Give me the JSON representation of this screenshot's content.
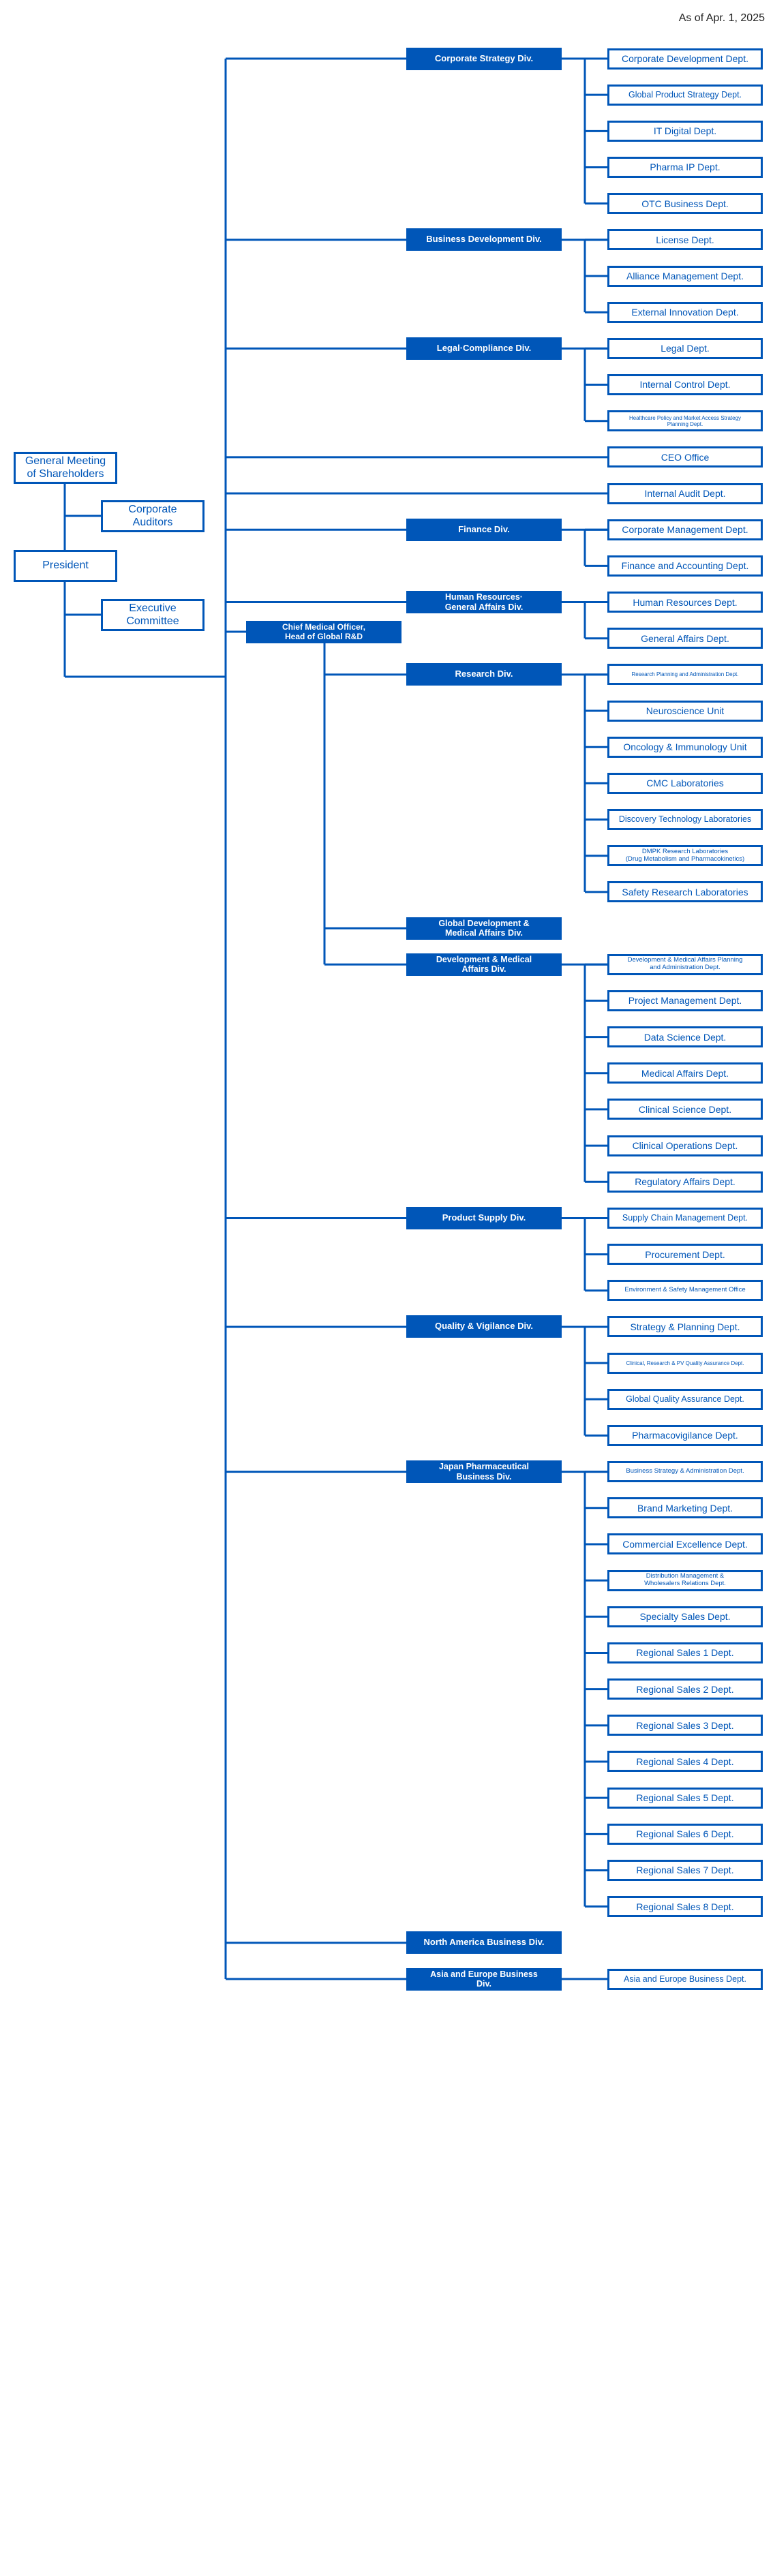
{
  "as_of": "As of Apr. 1, 2025",
  "colors": {
    "accent": "#0056b8",
    "background": "#ffffff"
  },
  "governance": {
    "general_meeting": "General Meeting\nof Shareholders",
    "corporate_auditors": "Corporate\nAuditors",
    "president": "President",
    "executive_committee": "Executive\nCommittee"
  },
  "cmo": "Chief Medical Officer,\nHead of Global R&D",
  "units": [
    {
      "type": "div",
      "name": "Corporate Strategy Div.",
      "depts": [
        "Corporate Development Dept.",
        "Global Product Strategy Dept.",
        "IT Digital Dept.",
        "Pharma IP Dept.",
        "OTC Business Dept."
      ]
    },
    {
      "type": "div",
      "name": "Business Development Div.",
      "depts": [
        "License Dept.",
        "Alliance Management Dept.",
        "External Innovation Dept."
      ]
    },
    {
      "type": "div",
      "name": "Legal·Compliance Div.",
      "depts": [
        "Legal Dept.",
        "Internal Control Dept.",
        "Healthcare Policy and Market Access Strategy\nPlanning Dept."
      ]
    },
    {
      "type": "office",
      "name": "CEO Office"
    },
    {
      "type": "office",
      "name": "Internal Audit Dept."
    },
    {
      "type": "div",
      "name": "Finance Div.",
      "depts": [
        "Corporate Management Dept.",
        "Finance and Accounting Dept."
      ]
    },
    {
      "type": "div",
      "name": "Human Resources·\nGeneral Affairs Div.",
      "depts": [
        "Human Resources Dept.",
        "General Affairs Dept."
      ]
    },
    {
      "type": "div",
      "cmo": true,
      "name": "Research Div.",
      "depts": [
        "Research Planning and Administration Dept.",
        "Neuroscience Unit",
        "Oncology & Immunology Unit",
        "CMC Laboratories",
        "Discovery Technology Laboratories",
        "DMPK Research Laboratories\n(Drug Metabolism and Pharmacokinetics)",
        "Safety Research Laboratories"
      ]
    },
    {
      "type": "div",
      "cmo": true,
      "name": "Global Development &\nMedical Affairs Div.",
      "depts": []
    },
    {
      "type": "div",
      "cmo": true,
      "name": "Development & Medical\nAffairs Div.",
      "depts": [
        "Development & Medical Affairs Planning\nand Administration Dept.",
        "Project Management Dept.",
        "Data Science Dept.",
        "Medical Affairs Dept.",
        "Clinical Science Dept.",
        "Clinical Operations Dept.",
        "Regulatory Affairs Dept."
      ]
    },
    {
      "type": "div",
      "name": "Product Supply Div.",
      "depts": [
        "Supply Chain Management Dept.",
        "Procurement Dept.",
        "Environment & Safety Management Office"
      ]
    },
    {
      "type": "div",
      "name": "Quality & Vigilance Div.",
      "depts": [
        "Strategy & Planning Dept.",
        "Clinical, Research & PV Quality Assurance Dept.",
        "Global Quality Assurance Dept.",
        "Pharmacovigilance Dept."
      ]
    },
    {
      "type": "div",
      "name": "Japan Pharmaceutical\nBusiness Div.",
      "depts": [
        "Business Strategy & Administration Dept.",
        "Brand Marketing Dept.",
        "Commercial Excellence Dept.",
        "Distribution Management &\nWholesalers Relations Dept.",
        "Specialty Sales Dept.",
        "Regional Sales 1 Dept.",
        "Regional Sales 2 Dept.",
        "Regional Sales 3 Dept.",
        "Regional Sales 4 Dept.",
        "Regional Sales 5 Dept.",
        "Regional Sales 6 Dept.",
        "Regional Sales 7 Dept.",
        "Regional Sales 8 Dept."
      ]
    },
    {
      "type": "div",
      "name": "North America Business Div.",
      "depts": []
    },
    {
      "type": "div",
      "name": "Asia and Europe Business\nDiv.",
      "depts": [
        "Asia and Europe Business Dept."
      ]
    }
  ]
}
